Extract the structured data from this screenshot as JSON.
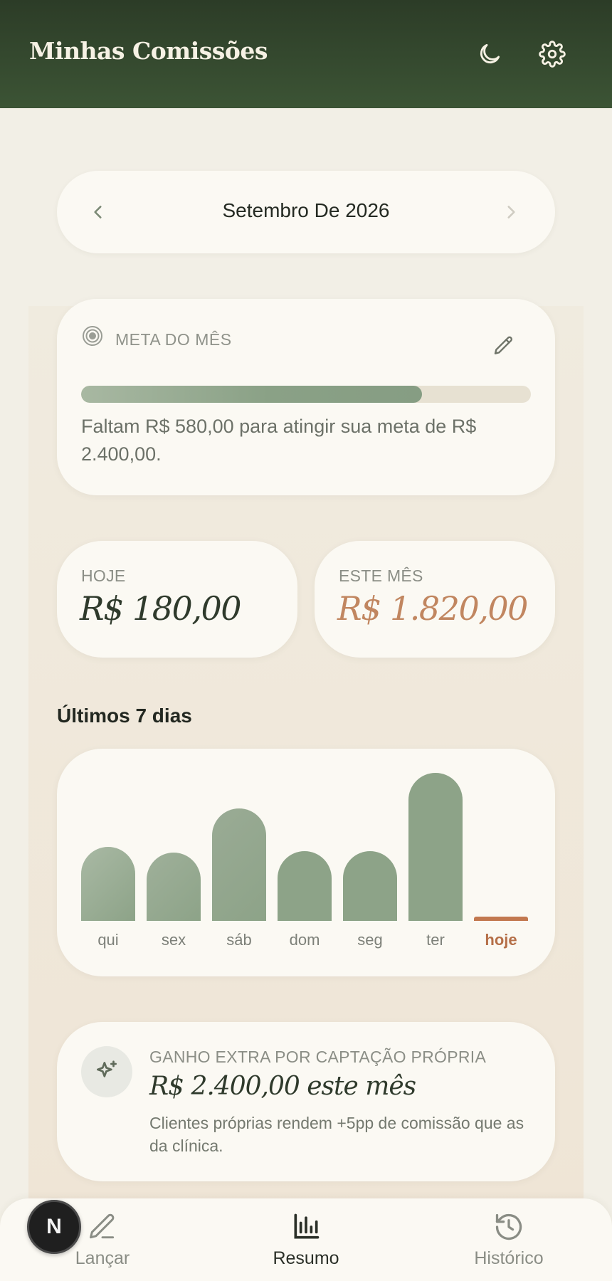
{
  "header": {
    "title": "Minhas Comissões",
    "theme_icon": "moon-icon",
    "settings_icon": "gear-icon"
  },
  "month_selector": {
    "label": "Setembro De 2026",
    "prev_icon": "chevron-left-icon",
    "next_icon": "chevron-right-icon"
  },
  "goal": {
    "label": "META DO MÊS",
    "icon": "target-icon",
    "edit_icon": "pencil-icon",
    "progress": 0.758,
    "message": "Faltam R$ 580,00 para atingir sua meta de R$ 2.400,00."
  },
  "stats": {
    "today_label": "HOJE",
    "today_value": "R$ 180,00",
    "month_label": "ESTE MÊS",
    "month_value": "R$ 1.820,00"
  },
  "last7": {
    "title": "Últimos 7 dias"
  },
  "chart_data": {
    "type": "bar",
    "categories": [
      "qui",
      "sex",
      "sáb",
      "dom",
      "seg",
      "ter",
      "hoje"
    ],
    "values": [
      0.5,
      0.46,
      0.76,
      0.47,
      0.47,
      1.0,
      0.03
    ],
    "highlight_category": "hoje",
    "colors": {
      "bar": "#8da388",
      "highlight": "#c2784f"
    },
    "title": "",
    "xlabel": "",
    "ylabel": ""
  },
  "extra": {
    "icon": "sparkle-icon",
    "label": "GANHO EXTRA POR CAPTAÇÃO PRÓPRIA",
    "value": "R$ 2.400,00 este mês",
    "description": "Clientes próprias rendem +5pp de comissão que as da clínica."
  },
  "nav": {
    "items": [
      {
        "label": "Lançar",
        "icon": "pencil-icon",
        "active": false
      },
      {
        "label": "Resumo",
        "icon": "bar-chart-icon",
        "active": true
      },
      {
        "label": "Histórico",
        "icon": "history-icon",
        "active": false
      }
    ]
  },
  "dev_badge": {
    "letter": "N"
  },
  "colors": {
    "header_bg": "#2c3c27",
    "accent_green": "#8da388",
    "accent_terracotta": "#c2784f",
    "page_bg": "#f2efe6",
    "card_bg": "#fbf9f3"
  }
}
